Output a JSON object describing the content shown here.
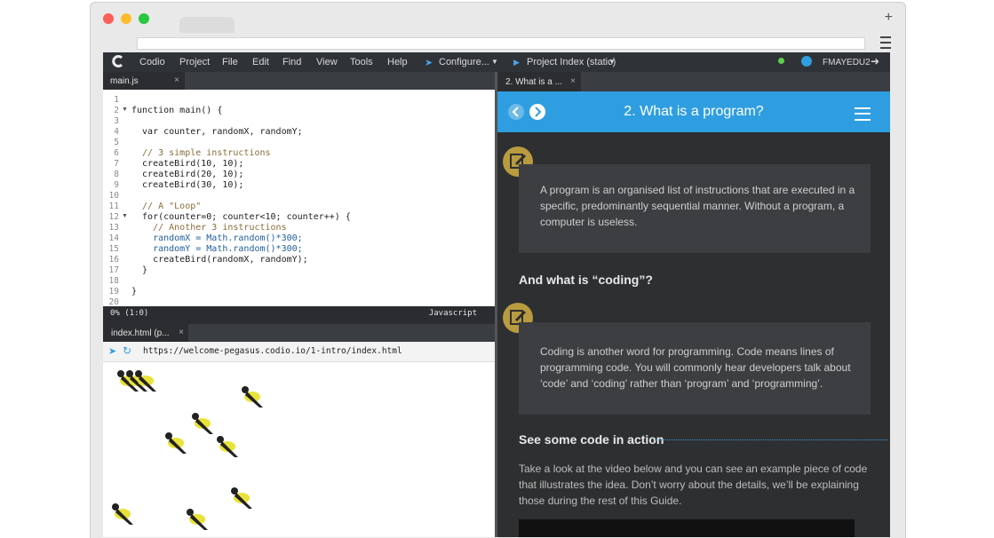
{
  "menubar": {
    "items": [
      "Codio",
      "Project",
      "File",
      "Edit",
      "Find",
      "View",
      "Tools",
      "Help"
    ],
    "configure_label": "Configure...",
    "project_index_label": "Project Index (static)",
    "username": "FMAYEDU2"
  },
  "editor": {
    "tab_label": "main.js",
    "line_numbers": [
      "1",
      "2",
      "3",
      "4",
      "5",
      "6",
      "7",
      "8",
      "9",
      "10",
      "11",
      "12",
      "13",
      "14",
      "15",
      "16",
      "17",
      "18",
      "19",
      "20"
    ],
    "lines": [
      "",
      "function main() {",
      "",
      "  var counter, randomX, randomY;",
      "",
      "  // 3 simple instructions",
      "  createBird(10, 10);",
      "  createBird(20, 10);",
      "  createBird(30, 10);",
      "",
      "  // A \"Loop\"",
      "  for(counter=0; counter<10; counter++) {",
      "    // Another 3 instructions",
      "    randomX = Math.random()*300;",
      "    randomY = Math.random()*300;",
      "    createBird(randomX, randomY);",
      "  }",
      "",
      "}",
      ""
    ],
    "status_left": "0%  (1:0)",
    "status_right": "Javascript"
  },
  "preview": {
    "tab_label": "index.html (p...",
    "url": "https://welcome-pegasus.codio.io/1-intro/index.html"
  },
  "guide": {
    "tab_label": "2. What is a ...",
    "title": "2. What is a program?",
    "paragraph1": "A program is an organised list of instructions that are executed in a specific, predominantly sequential manner. Without a program, a computer is useless.",
    "heading2": "And what is “coding”?",
    "paragraph2": "Coding is another word for programming. Code means lines of programming code. You will commonly hear developers talk about ‘code’ and ‘coding’ rather than ‘program’ and ‘programming’.",
    "heading3": "See some code in action",
    "paragraph3": "Take a look at the video below and you can see an example piece of code that illustrates the idea. Don’t worry about the details, we’ll be explaining those during the rest of this Guide."
  },
  "colors": {
    "accent": "#2f9ee0",
    "bird_yellow": "#e8e23a",
    "note_gold": "#b89b3e"
  }
}
